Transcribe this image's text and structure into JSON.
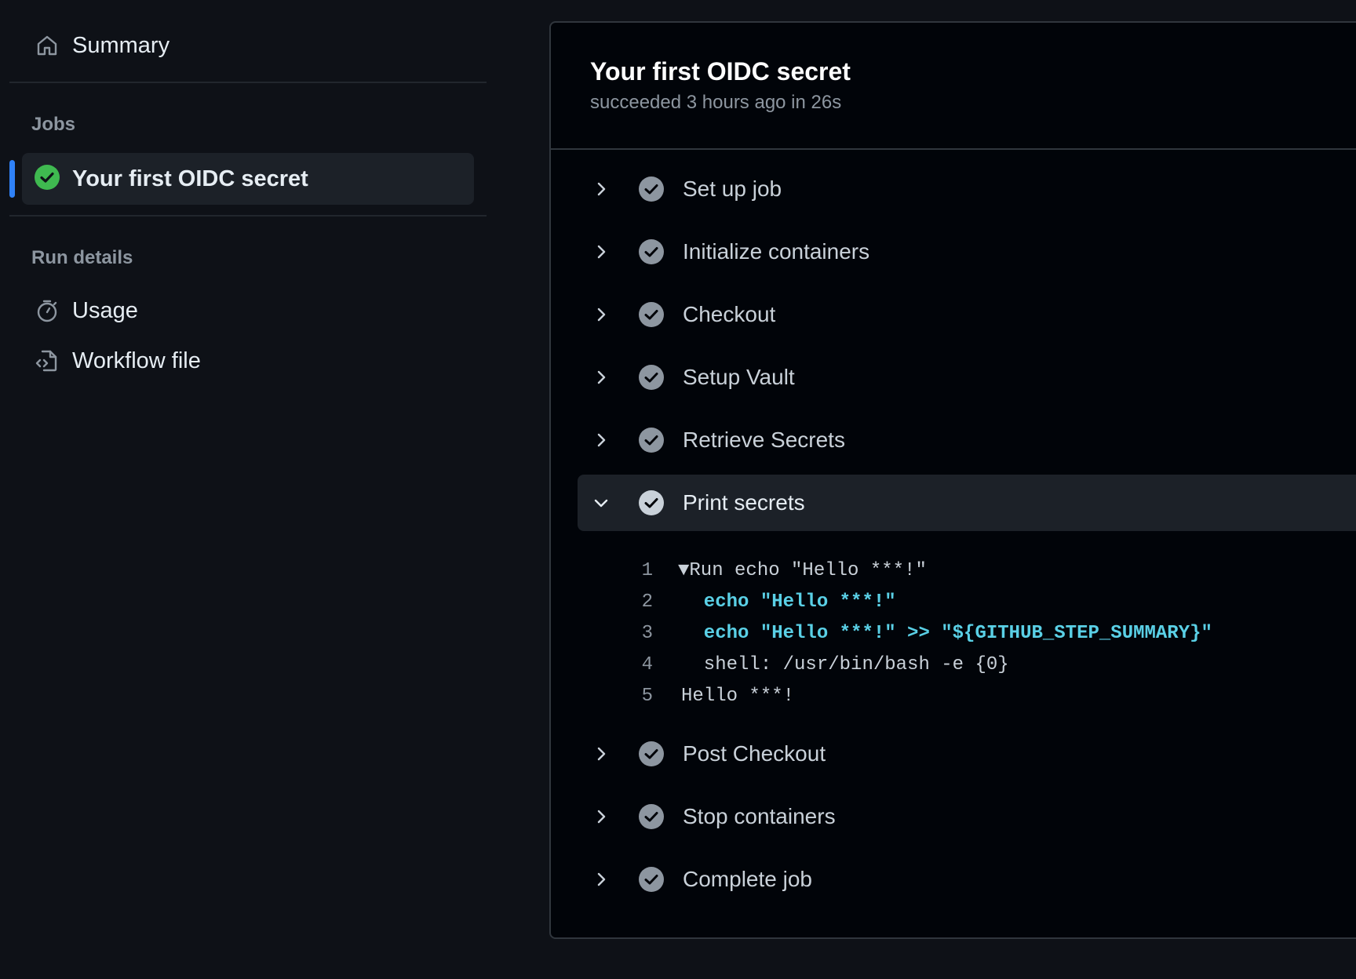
{
  "sidebar": {
    "summary_label": "Summary",
    "jobs_title": "Jobs",
    "job": {
      "label": "Your first OIDC secret",
      "status": "success"
    },
    "run_details_title": "Run details",
    "usage_label": "Usage",
    "workflow_file_label": "Workflow file"
  },
  "panel": {
    "title": "Your first OIDC secret",
    "subtitle": "succeeded 3 hours ago in 26s"
  },
  "steps": [
    {
      "label": "Set up job",
      "expanded": false
    },
    {
      "label": "Initialize containers",
      "expanded": false
    },
    {
      "label": "Checkout",
      "expanded": false
    },
    {
      "label": "Setup Vault",
      "expanded": false
    },
    {
      "label": "Retrieve Secrets",
      "expanded": false
    },
    {
      "label": "Print secrets",
      "expanded": true
    },
    {
      "label": "Post Checkout",
      "expanded": false
    },
    {
      "label": "Stop containers",
      "expanded": false
    },
    {
      "label": "Complete job",
      "expanded": false
    }
  ],
  "log": [
    {
      "num": "1",
      "toggle": "▼",
      "text": "Run echo \"Hello ***!\"",
      "style": "plain"
    },
    {
      "num": "2",
      "toggle": "",
      "text": "  echo \"Hello ***!\"",
      "style": "cmd"
    },
    {
      "num": "3",
      "toggle": "",
      "text": "  echo \"Hello ***!\" >> \"${GITHUB_STEP_SUMMARY}\"",
      "style": "cmd"
    },
    {
      "num": "4",
      "toggle": "",
      "text": "  shell: /usr/bin/bash -e {0}",
      "style": "plain"
    },
    {
      "num": "5",
      "toggle": "",
      "text": "Hello ***!",
      "style": "plain"
    }
  ],
  "colors": {
    "success": "#3fb950",
    "step_check": "#8d96a0",
    "accent": "#2f81f7",
    "command": "#5ad0e6"
  }
}
